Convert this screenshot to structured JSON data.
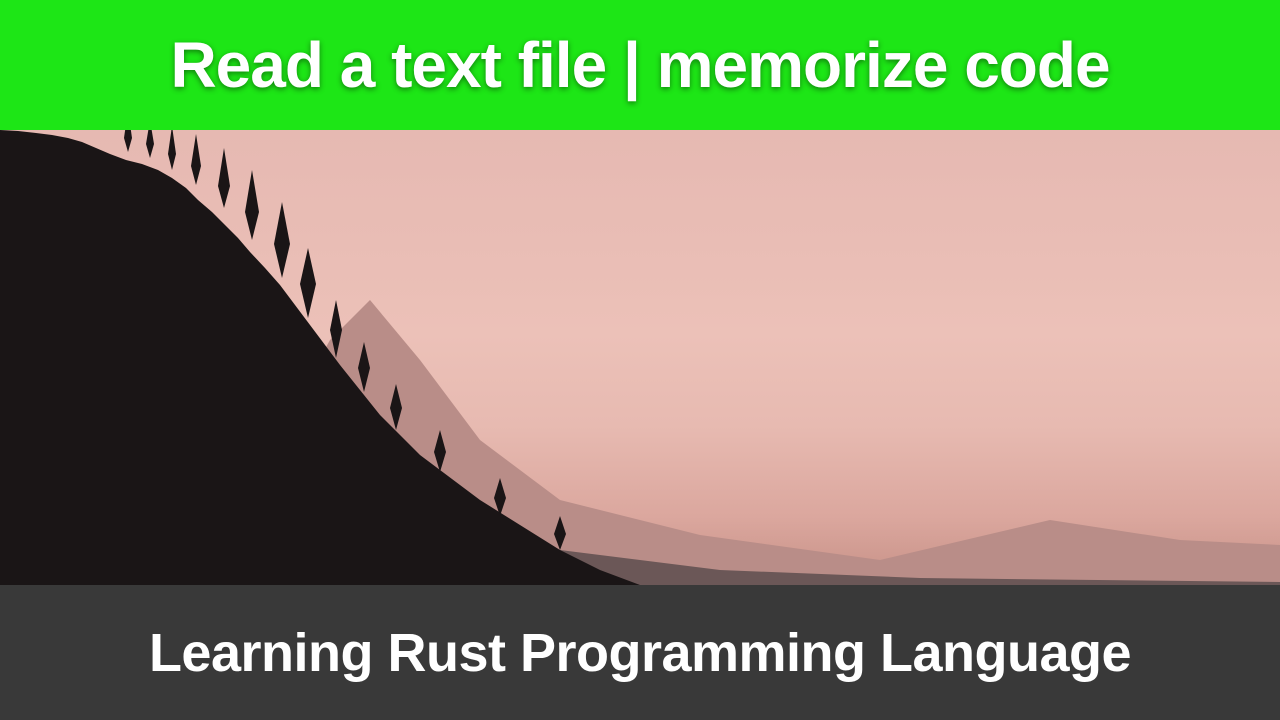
{
  "top": {
    "title": "Read a text file | memorize code",
    "bg_color": "#1de616",
    "text_color": "#ffffff"
  },
  "bottom": {
    "title": "Learning Rust Programming Language",
    "bg_color": "rgba(40,40,40,0.92)",
    "text_color": "#ffffff"
  },
  "scene": {
    "description": "mountain-silhouette-sunset",
    "sky_gradient": [
      "#e6b9b2",
      "#dba79e"
    ],
    "ridge_far_color": "#b98d88",
    "ridge_mid_color": "#5b4a4a",
    "ridge_near_color": "#1a1516"
  }
}
